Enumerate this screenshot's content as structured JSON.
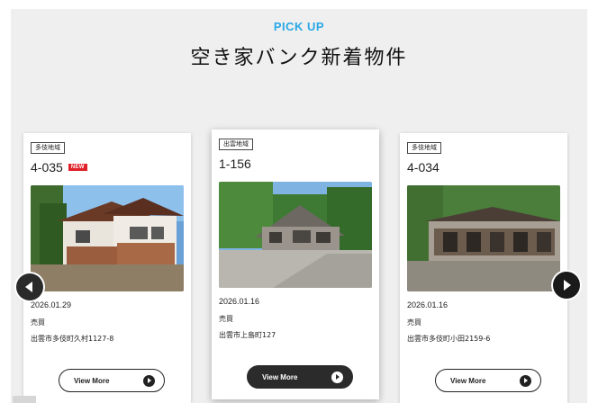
{
  "section": {
    "label": "PICK UP",
    "title": "空き家バンク新着物件"
  },
  "colors": {
    "accent": "#2aa8e6",
    "new_badge": "#e0212b",
    "panel_bg": "#efefef"
  },
  "navigation": {
    "prev_icon": "chevron-left-icon",
    "next_icon": "chevron-right-icon"
  },
  "cards": [
    {
      "area": "多伎地域",
      "id": "4-035",
      "badge": "NEW",
      "date": "2026.01.29",
      "type": "売買",
      "address": "出雲市多伎町久村1127-8",
      "button": "View More",
      "photo_icon": "house-photo"
    },
    {
      "area": "出雲地域",
      "id": "1-156",
      "badge": "",
      "date": "2026.01.16",
      "type": "売買",
      "address": "出雲市上島町127",
      "button": "View More",
      "photo_icon": "house-photo"
    },
    {
      "area": "多伎地域",
      "id": "4-034",
      "badge": "",
      "date": "2026.01.16",
      "type": "売買",
      "address": "出雲市多伎町小田2159-6",
      "button": "View More",
      "photo_icon": "house-photo"
    }
  ]
}
